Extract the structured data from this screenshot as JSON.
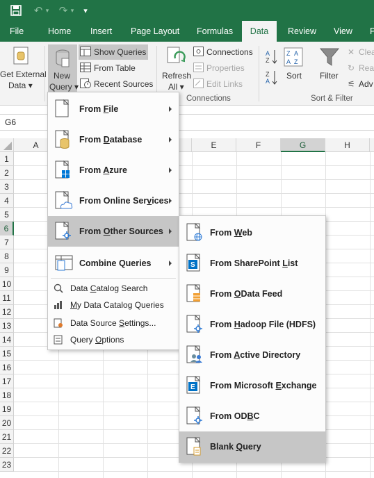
{
  "titlebar": {
    "save_icon": "save-icon",
    "undo_icon": "undo-icon",
    "redo_icon": "redo-icon",
    "customize_icon": "customize-quick-access-icon"
  },
  "tabs": [
    "File",
    "Home",
    "Insert",
    "Page Layout",
    "Formulas",
    "Data",
    "Review",
    "View",
    "P"
  ],
  "active_tab": "Data",
  "ribbon": {
    "get_external_1": "Get External",
    "get_external_2": "Data",
    "new_query_1": "New",
    "new_query_2": "Query",
    "show_queries": "Show Queries",
    "from_table": "From Table",
    "recent_sources": "Recent Sources",
    "refresh_1": "Refresh",
    "refresh_2": "All",
    "connections": "Connections",
    "properties": "Properties",
    "edit_links": "Edit Links",
    "connections_group": "Connections",
    "sort": "Sort",
    "filter": "Filter",
    "clear": "Clea",
    "reapply": "Reap",
    "advanced": "Adv",
    "sort_filter_group": "Sort & Filter"
  },
  "name_box": "G6",
  "columns": [
    "A",
    "E",
    "F",
    "G",
    "H"
  ],
  "selected_column": "G",
  "rows": [
    "1",
    "2",
    "3",
    "4",
    "5",
    "6",
    "7",
    "8",
    "9",
    "10",
    "11",
    "12",
    "13",
    "14",
    "15",
    "16",
    "17",
    "18",
    "19",
    "20",
    "21",
    "22",
    "23"
  ],
  "selected_row": "6",
  "new_query_menu": {
    "items": [
      {
        "pre": "From ",
        "key": "F",
        "post": "ile",
        "icon": "file-icon"
      },
      {
        "pre": "From ",
        "key": "D",
        "post": "atabase",
        "icon": "database-icon"
      },
      {
        "pre": "From ",
        "key": "A",
        "post": "zure",
        "icon": "azure-icon"
      },
      {
        "pre": "From Online Ser",
        "key": "v",
        "post": "ices",
        "icon": "cloud-icon"
      },
      {
        "pre": "From ",
        "key": "O",
        "post": "ther Sources",
        "icon": "other-sources-icon"
      },
      {
        "pre": "Combine Queries",
        "key": "",
        "post": "",
        "icon": "combine-icon"
      }
    ],
    "small_items": [
      {
        "pre": "Data ",
        "key": "C",
        "post": "atalog Search",
        "icon": "catalog-search-icon"
      },
      {
        "pre": "",
        "key": "M",
        "post": "y Data Catalog Queries",
        "icon": "catalog-queries-icon"
      },
      {
        "pre": "Data Source ",
        "key": "S",
        "post": "ettings...",
        "icon": "settings-icon"
      },
      {
        "pre": "Query ",
        "key": "O",
        "post": "ptions",
        "icon": "options-icon"
      }
    ]
  },
  "other_sources_menu": {
    "items": [
      {
        "pre": "From ",
        "key": "W",
        "post": "eb",
        "icon": "web-icon"
      },
      {
        "pre": "From SharePoint ",
        "key": "L",
        "post": "ist",
        "icon": "sharepoint-icon"
      },
      {
        "pre": "From ",
        "key": "O",
        "post": "Data Feed",
        "icon": "odata-icon"
      },
      {
        "pre": "From ",
        "key": "H",
        "post": "adoop File (HDFS)",
        "icon": "hadoop-icon"
      },
      {
        "pre": "From ",
        "key": "A",
        "post": "ctive Directory",
        "icon": "active-directory-icon"
      },
      {
        "pre": "From Microsoft ",
        "key": "E",
        "post": "xchange",
        "icon": "exchange-icon"
      },
      {
        "pre": "From OD",
        "key": "B",
        "post": "C",
        "icon": "odbc-icon"
      },
      {
        "pre": "Blank ",
        "key": "Q",
        "post": "uery",
        "icon": "blank-query-icon"
      }
    ]
  },
  "colors": {
    "accent": "#217346",
    "hover": "#c6c6c6",
    "sharepoint": "#0072c6",
    "odata": "#f2a034"
  }
}
